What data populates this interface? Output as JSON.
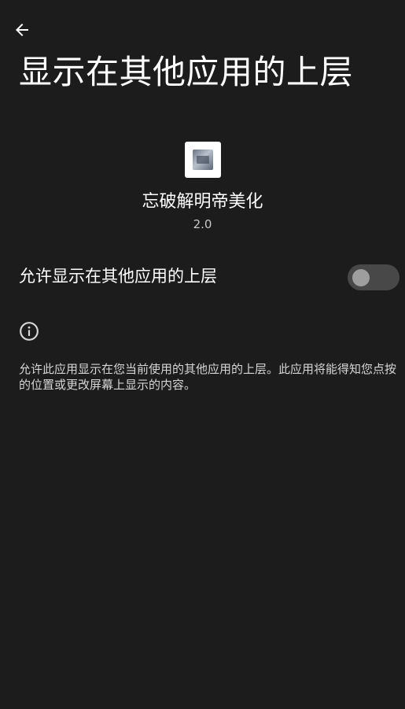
{
  "header": {
    "back_icon": "arrow-back-icon",
    "title": "显示在其他应用的上层"
  },
  "app": {
    "icon": "app-icon",
    "name": "忘破解明帝美化",
    "version": "2.0"
  },
  "setting": {
    "label": "允许显示在其他应用的上层",
    "enabled": false
  },
  "info": {
    "icon": "info-icon",
    "text": "允许此应用显示在您当前使用的其他应用的上层。此应用将能得知您点按的位置或更改屏幕上显示的内容。"
  },
  "colors": {
    "background": "#1c1c1c",
    "text_primary": "#ffffff",
    "text_secondary": "#d6d6d6",
    "toggle_track_off": "#484848",
    "toggle_thumb_off": "#9e9e9e"
  }
}
